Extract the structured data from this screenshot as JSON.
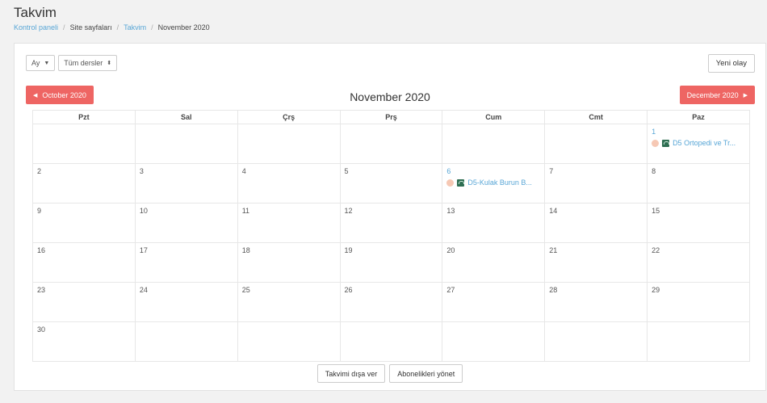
{
  "page": {
    "title": "Takvim",
    "breadcrumb": [
      "Kontrol paneli",
      "Site sayfaları",
      "Takvim",
      "November 2020"
    ]
  },
  "controls": {
    "view_select": "Ay",
    "course_select": "Tüm dersler",
    "new_event": "Yeni olay"
  },
  "nav": {
    "prev": "October 2020",
    "next": "December 2020",
    "current": "November 2020"
  },
  "weekdays": [
    "Pzt",
    "Sal",
    "Çrş",
    "Prş",
    "Cum",
    "Cmt",
    "Paz"
  ],
  "weeks": [
    [
      "",
      "",
      "",
      "",
      "",
      "",
      "1"
    ],
    [
      "2",
      "3",
      "4",
      "5",
      "6",
      "7",
      "8"
    ],
    [
      "9",
      "10",
      "11",
      "12",
      "13",
      "14",
      "15"
    ],
    [
      "16",
      "17",
      "18",
      "19",
      "20",
      "21",
      "22"
    ],
    [
      "23",
      "24",
      "25",
      "26",
      "27",
      "28",
      "29"
    ],
    [
      "30",
      "",
      "",
      "",
      "",
      "",
      ""
    ]
  ],
  "events": {
    "nov1": "D5 Ortopedi ve Tr...",
    "nov6": "D5-Kulak Burun B..."
  },
  "footer": {
    "export": "Takvimi dışa ver",
    "subscriptions": "Abonelikleri yönet"
  },
  "colors": {
    "accent": "#ee6563",
    "link": "#58a6d6",
    "event_dot": "#f6c8b4",
    "event_icon": "#2e6e52"
  }
}
